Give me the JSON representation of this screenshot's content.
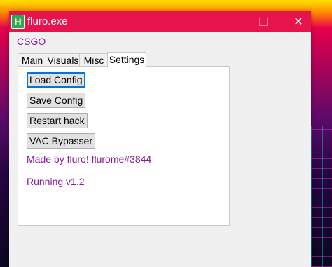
{
  "window": {
    "title": "fluro.exe",
    "icon_letter": "H",
    "controls": {
      "minimize": "minimize-icon",
      "maximize": "maximize-icon",
      "close": "✕"
    }
  },
  "app_label": "CSGO",
  "tabs": [
    {
      "label": "Main"
    },
    {
      "label": "Visuals"
    },
    {
      "label": "Misc"
    },
    {
      "label": "Settings",
      "selected": true
    }
  ],
  "settings": {
    "buttons": [
      {
        "label": "Load Config"
      },
      {
        "label": "Save Config"
      },
      {
        "label": "Restart hack"
      },
      {
        "label": "VAC Bypasser"
      }
    ],
    "credit_text": "Made by fluro! flurome#3844",
    "status_text": "Running v1.2"
  },
  "colors": {
    "titlebar": "#e8134d",
    "accent_text": "#8b1a9b",
    "focus_border": "#0078d7",
    "icon_bg": "#2fa84f"
  }
}
